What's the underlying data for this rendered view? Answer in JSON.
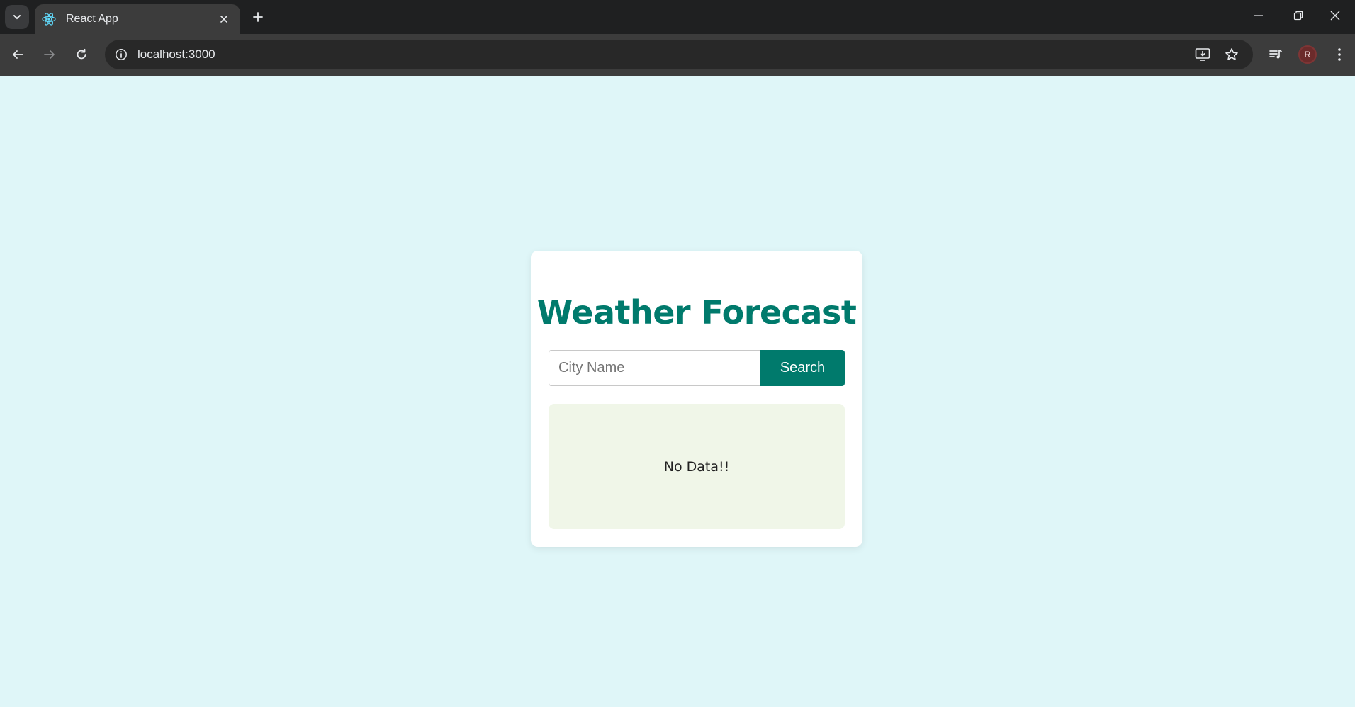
{
  "browser": {
    "tab": {
      "title": "React App",
      "favicon": "react-logo-icon"
    },
    "address_bar": {
      "url": "localhost:3000"
    },
    "profile_initial": "R",
    "icons": {
      "tab_search": "chevron-down-icon",
      "close_tab": "close-icon",
      "new_tab": "plus-icon",
      "back": "arrow-left-icon",
      "forward": "arrow-right-icon",
      "reload": "reload-icon",
      "site_info": "info-icon",
      "install": "install-app-icon",
      "bookmark": "star-icon",
      "media": "media-controls-icon",
      "menu": "kebab-menu-icon",
      "minimize": "minimize-icon",
      "restore": "restore-icon",
      "close_window": "close-icon"
    }
  },
  "app": {
    "title": "Weather Forecast",
    "search": {
      "placeholder": "City Name",
      "value": "",
      "button_label": "Search"
    },
    "result": {
      "empty_text": "No Data!!"
    }
  },
  "colors": {
    "page_background": "#dff6f8",
    "accent": "#007a6c",
    "card_background": "#ffffff",
    "result_background": "#f0f6e8",
    "chrome_dark": "#1f2021",
    "chrome_toolbar": "#3c3c3c"
  }
}
